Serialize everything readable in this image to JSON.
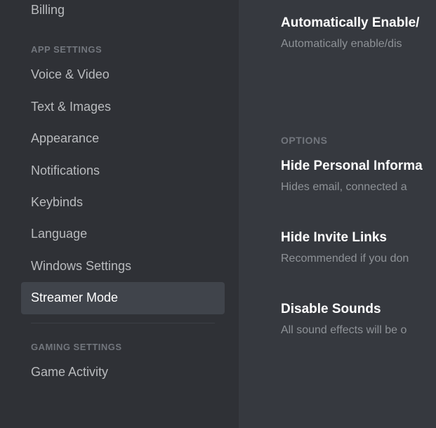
{
  "sidebar": {
    "top_partial": "Billing",
    "section_app": "APP SETTINGS",
    "items": [
      {
        "label": "Voice & Video"
      },
      {
        "label": "Text & Images"
      },
      {
        "label": "Appearance"
      },
      {
        "label": "Notifications"
      },
      {
        "label": "Keybinds"
      },
      {
        "label": "Language"
      },
      {
        "label": "Windows Settings"
      },
      {
        "label": "Streamer Mode"
      }
    ],
    "section_gaming": "GAMING SETTINGS",
    "gaming_items": [
      {
        "label": "Game Activity"
      }
    ]
  },
  "main": {
    "auto_enable": {
      "title": "Automatically Enable/",
      "desc": "Automatically enable/dis"
    },
    "options_header": "OPTIONS",
    "options": [
      {
        "title": "Hide Personal Informa",
        "desc": "Hides email, connected a"
      },
      {
        "title": "Hide Invite Links",
        "desc": "Recommended if you don"
      },
      {
        "title": "Disable Sounds",
        "desc": "All sound effects will be o"
      }
    ]
  }
}
